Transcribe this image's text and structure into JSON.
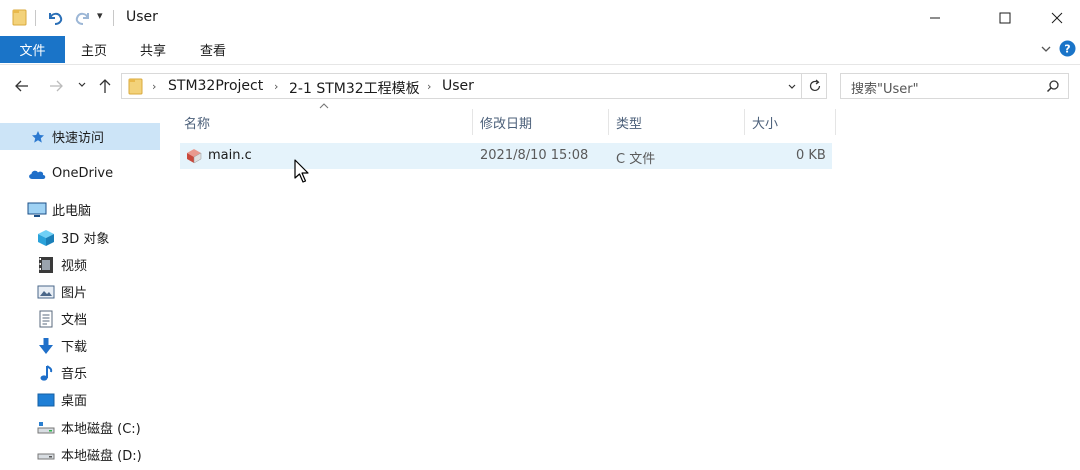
{
  "window": {
    "title": "User",
    "qat_dropdown": "▾"
  },
  "ribbon": {
    "tabs": [
      "文件",
      "主页",
      "共享",
      "查看"
    ]
  },
  "address": {
    "breadcrumbs": [
      "STM32Project",
      "2-1 STM32工程模板",
      "User"
    ]
  },
  "search": {
    "placeholder": "搜索\"User\""
  },
  "nav_pane": {
    "items": [
      {
        "label": "快速访问",
        "icon": "star-icon"
      },
      {
        "label": "OneDrive",
        "icon": "cloud-icon"
      },
      {
        "label": "此电脑",
        "icon": "computer-icon"
      },
      {
        "label": "3D 对象",
        "icon": "cube-icon"
      },
      {
        "label": "视频",
        "icon": "video-icon"
      },
      {
        "label": "图片",
        "icon": "picture-icon"
      },
      {
        "label": "文档",
        "icon": "document-icon"
      },
      {
        "label": "下载",
        "icon": "download-icon"
      },
      {
        "label": "音乐",
        "icon": "music-icon"
      },
      {
        "label": "桌面",
        "icon": "desktop-icon"
      },
      {
        "label": "本地磁盘 (C:)",
        "icon": "drive-icon"
      },
      {
        "label": "本地磁盘 (D:)",
        "icon": "drive-icon"
      }
    ]
  },
  "file_list": {
    "columns": [
      "名称",
      "修改日期",
      "类型",
      "大小"
    ],
    "rows": [
      {
        "name": "main.c",
        "modified": "2021/8/10 15:08",
        "type": "C 文件",
        "size": "0 KB"
      }
    ]
  },
  "colors": {
    "accent": "#1a74c8",
    "selection": "#cce4f7",
    "hover_row": "#e5f3fb"
  }
}
